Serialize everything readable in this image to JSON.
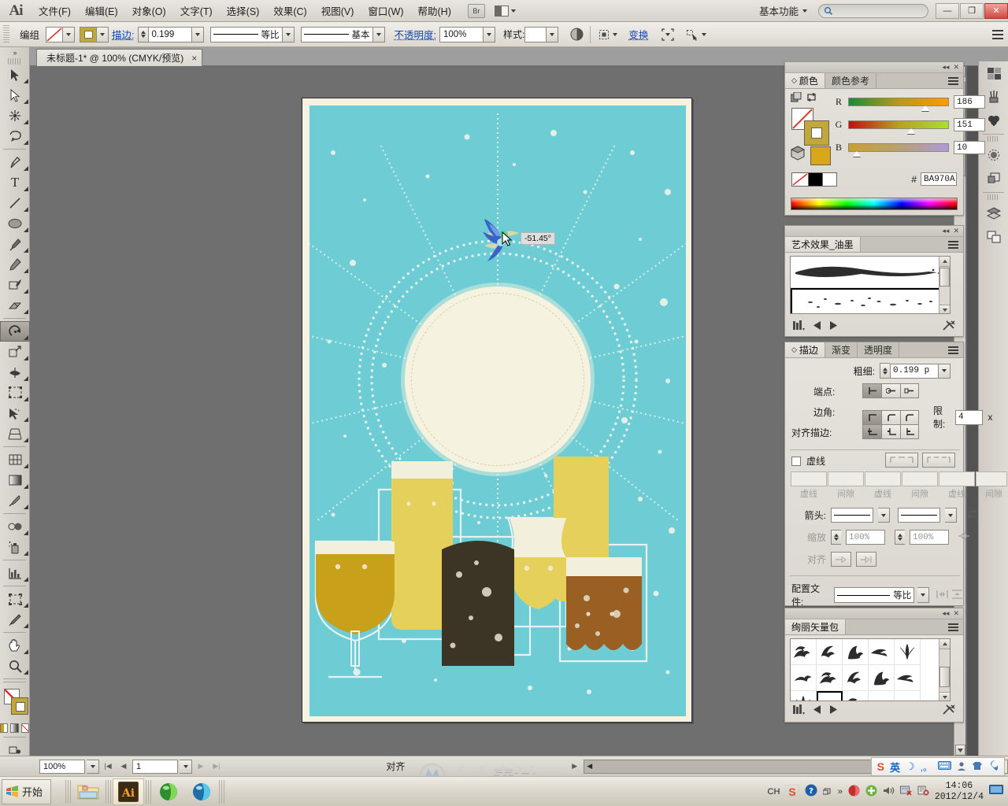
{
  "app": {
    "name": "Ai",
    "logo": "Ai"
  },
  "menubar": {
    "items": [
      "文件(F)",
      "编辑(E)",
      "对象(O)",
      "文字(T)",
      "选择(S)",
      "效果(C)",
      "视图(V)",
      "窗口(W)",
      "帮助(H)"
    ],
    "bridge_label": "Br",
    "workspace": "基本功能",
    "search_placeholder": "",
    "window_buttons": {
      "minimize": "—",
      "restore": "❐",
      "close": "✕"
    }
  },
  "controlbar": {
    "selection_label": "编组",
    "stroke_label": "描边:",
    "stroke_weight": "0.199",
    "profile_label": "等比",
    "brush_label": "基本",
    "opacity_label": "不透明度:",
    "opacity_value": "100%",
    "style_label": "样式:",
    "transform_label": "变换",
    "align_icon": "align-icon",
    "isolate_icon": "isolate-icon"
  },
  "document": {
    "tab_title": "未标题-1* @ 100% (CMYK/预览)",
    "close_label": "×"
  },
  "toolbar": {
    "tools": [
      {
        "name": "selection-tool",
        "glyph": "arrow"
      },
      {
        "name": "direct-selection-tool",
        "glyph": "arrow-white"
      },
      {
        "name": "magic-wand-tool",
        "glyph": "wand"
      },
      {
        "name": "lasso-tool",
        "glyph": "lasso"
      },
      {
        "name": "pen-tool",
        "glyph": "pen"
      },
      {
        "name": "type-tool",
        "glyph": "T"
      },
      {
        "name": "line-segment-tool",
        "glyph": "line"
      },
      {
        "name": "ellipse-tool",
        "glyph": "ellipse"
      },
      {
        "name": "paintbrush-tool",
        "glyph": "brush"
      },
      {
        "name": "pencil-tool",
        "glyph": "pencil"
      },
      {
        "name": "blob-brush-tool",
        "glyph": "blob"
      },
      {
        "name": "eraser-tool",
        "glyph": "eraser"
      },
      {
        "name": "rotate-tool",
        "glyph": "rotate",
        "selected": true
      },
      {
        "name": "scale-tool",
        "glyph": "scale"
      },
      {
        "name": "width-tool",
        "glyph": "width"
      },
      {
        "name": "free-transform-tool",
        "glyph": "free-transform"
      },
      {
        "name": "shape-builder-tool",
        "glyph": "shape-builder"
      },
      {
        "name": "perspective-grid-tool",
        "glyph": "perspective"
      },
      {
        "name": "mesh-tool",
        "glyph": "mesh"
      },
      {
        "name": "gradient-tool",
        "glyph": "gradient"
      },
      {
        "name": "eyedropper-tool",
        "glyph": "eyedropper"
      },
      {
        "name": "blend-tool",
        "glyph": "blend"
      },
      {
        "name": "symbol-sprayer-tool",
        "glyph": "sprayer"
      },
      {
        "name": "column-graph-tool",
        "glyph": "graph"
      },
      {
        "name": "artboard-tool",
        "glyph": "artboard"
      },
      {
        "name": "slice-tool",
        "glyph": "slice"
      },
      {
        "name": "hand-tool",
        "glyph": "hand"
      },
      {
        "name": "zoom-tool",
        "glyph": "zoom"
      }
    ]
  },
  "color_panel": {
    "tabs": [
      {
        "label": "颜色",
        "active": true
      },
      {
        "label": "颜色参考",
        "active": false
      }
    ],
    "channels": [
      {
        "label": "R",
        "value": "186",
        "pct": 73
      },
      {
        "label": "G",
        "value": "151",
        "pct": 59
      },
      {
        "label": "B",
        "value": "10",
        "pct": 4
      }
    ],
    "hex_label": "#",
    "hex_value": "BA970A",
    "fill_color": "#BA970A"
  },
  "brushes_panel": {
    "title": "艺术效果_油墨",
    "items": [
      {
        "name": "ink-brush-stroke-1",
        "selected": false
      },
      {
        "name": "ink-brush-spatter-2",
        "selected": true
      },
      {
        "name": "ink-brush-stroke-3",
        "selected": false
      }
    ]
  },
  "stroke_panel": {
    "tabs": [
      {
        "label": "描边",
        "active": true
      },
      {
        "label": "渐变",
        "active": false
      },
      {
        "label": "透明度",
        "active": false
      }
    ],
    "weight_label": "粗细:",
    "weight_value": "0.199 p",
    "cap_label": "端点:",
    "corner_label": "边角:",
    "limit_label": "限制:",
    "limit_value": "4",
    "limit_unit": "x",
    "align_label": "对齐描边:",
    "dashed_label": "虚线",
    "dash_fields": [
      "虚线",
      "间隙",
      "虚线",
      "间隙",
      "虚线",
      "间隙"
    ],
    "arrow_label": "箭头:",
    "scale_label": "缩放",
    "scale_values": [
      "100%",
      "100%"
    ],
    "align_arrow_label": "对齐",
    "profile_label": "配置文件:",
    "profile_value": "等比"
  },
  "symbols_panel": {
    "title": "绚丽矢量包",
    "rows": 3,
    "cols": 6,
    "selected_index": 11
  },
  "statusbar": {
    "zoom": "100%",
    "page": "1",
    "status_text": "对齐"
  },
  "artwork": {
    "tooltip_angle": "-51.45°",
    "colors": {
      "background": "#6ecdd4",
      "paper": "#f6f2e2",
      "beer_gold": "#c8a01a",
      "beer_light": "#e4d05a",
      "beer_dark": "#3c3526",
      "beer_brown": "#9a5f22",
      "foam": "#f3efdd"
    }
  },
  "taskbar": {
    "start_label": "开始",
    "quick_items": [
      "explorer-icon",
      "illustrator-icon",
      "browser-green-icon",
      "browser-blue-icon"
    ],
    "tray_lang": "CH",
    "time": "14:06",
    "date": "2012/12/4",
    "ime_items": [
      "sogou-icon",
      "英",
      "moon-icon",
      "punct-icon",
      "keyboard-icon",
      "user-icon",
      "skin-icon",
      "tools-icon"
    ]
  },
  "watermark": {
    "text": "人人素材"
  }
}
